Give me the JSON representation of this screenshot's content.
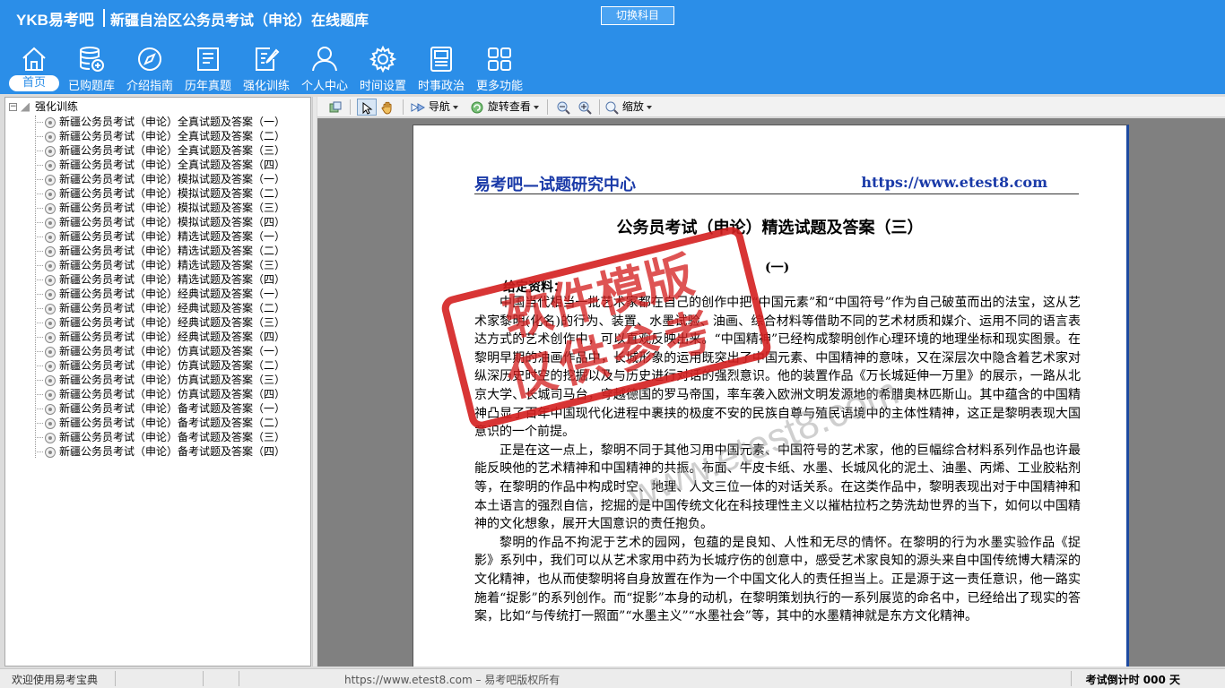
{
  "header": {
    "logo": "YKB易考吧",
    "title": "新疆自治区公务员考试（申论）在线题库",
    "switch_label": "切换科目"
  },
  "nav": {
    "items": [
      {
        "label": "首页",
        "icon": "home-icon"
      },
      {
        "label": "已购题库",
        "icon": "database-icon"
      },
      {
        "label": "介绍指南",
        "icon": "compass-icon"
      },
      {
        "label": "历年真题",
        "icon": "document-list-icon"
      },
      {
        "label": "强化训练",
        "icon": "edit-document-icon"
      },
      {
        "label": "个人中心",
        "icon": "user-icon"
      },
      {
        "label": "时间设置",
        "icon": "gear-icon"
      },
      {
        "label": "时事政治",
        "icon": "news-icon"
      },
      {
        "label": "更多功能",
        "icon": "grid-icon"
      }
    ],
    "active": 0
  },
  "tree": {
    "root": "强化训练",
    "items": [
      "新疆公务员考试（申论）全真试题及答案（一）",
      "新疆公务员考试（申论）全真试题及答案（二）",
      "新疆公务员考试（申论）全真试题及答案（三）",
      "新疆公务员考试（申论）全真试题及答案（四）",
      "新疆公务员考试（申论）模拟试题及答案（一）",
      "新疆公务员考试（申论）模拟试题及答案（二）",
      "新疆公务员考试（申论）模拟试题及答案（三）",
      "新疆公务员考试（申论）模拟试题及答案（四）",
      "新疆公务员考试（申论）精选试题及答案（一）",
      "新疆公务员考试（申论）精选试题及答案（二）",
      "新疆公务员考试（申论）精选试题及答案（三）",
      "新疆公务员考试（申论）精选试题及答案（四）",
      "新疆公务员考试（申论）经典试题及答案（一）",
      "新疆公务员考试（申论）经典试题及答案（二）",
      "新疆公务员考试（申论）经典试题及答案（三）",
      "新疆公务员考试（申论）经典试题及答案（四）",
      "新疆公务员考试（申论）仿真试题及答案（一）",
      "新疆公务员考试（申论）仿真试题及答案（二）",
      "新疆公务员考试（申论）仿真试题及答案（三）",
      "新疆公务员考试（申论）仿真试题及答案（四）",
      "新疆公务员考试（申论）备考试题及答案（一）",
      "新疆公务员考试（申论）备考试题及答案（二）",
      "新疆公务员考试（申论）备考试题及答案（三）",
      "新疆公务员考试（申论）备考试题及答案（四）"
    ]
  },
  "toolbar": {
    "navigate": "导航",
    "rotate": "旋转查看",
    "zoom": "缩放"
  },
  "document": {
    "header_left": "易考吧—试题研究中心",
    "header_right": "https://www.etest8.com",
    "title": "公务员考试（申论）精选试题及答案（三）",
    "section": "(一)",
    "given_label": "给定资料：",
    "paragraphs": [
      "中国当代相当一批艺术家都在自己的创作中把“中国元素”和“中国符号”作为自己破茧而出的法宝，这从艺术家黎明(化名)的行为、装置、水墨试验、油画、综合材料等借助不同的艺术材质和媒介、运用不同的语言表达方式的艺术创作中，可以直观反映出来。“中国精神”已经构成黎明创作心理环境的地理坐标和现实图景。在黎明早期的油画作品中，长城形象的运用既突出了中国元素、中国精神的意味，又在深层次中隐含着艺术家对纵深历史时空的挖掘以及与历史进行对话的强烈意识。他的装置作品《万长城延伸一万里》的展示，一路从北京大学、长城司马台，穿越德国的罗马帝国，率车袭入欧洲文明发源地的希腊奥林匹斯山。其中蕴含的中国精神凸显了百年中国现代化进程中裹挟的极度不安的民族自尊与殖民语境中的主体性精神，这正是黎明表现大国意识的一个前提。",
      "正是在这一点上，黎明不同于其他习用中国元素、中国符号的艺术家，他的巨幅综合材料系列作品也许最能反映他的艺术精神和中国精神的共振。布面、牛皮卡纸、水墨、长城风化的泥土、油墨、丙烯、工业胶粘剂等，在黎明的作品中构成时空、地理、人文三位一体的对话关系。在这类作品中，黎明表现出对于中国精神和本土语言的强烈自信，挖掘的是中国传统文化在科技理性主义以摧枯拉朽之势洗劫世界的当下，如何以中国精神的文化想象，展开大国意识的责任抱负。",
      "黎明的作品不拘泥于艺术的园网，包蕴的是良知、人性和无尽的情怀。在黎明的行为水墨实验作品《捉影》系列中，我们可以从艺术家用中药为长城疗伤的创意中，感受艺术家良知的源头来自中国传统博大精深的文化精神，也从而使黎明将自身放置在作为一个中国文化人的责任担当上。正是源于这一责任意识，他一路实施着“捉影”的系列创作。而“捉影”本身的动机，在黎明策划执行的一系列展览的命名中，已经给出了现实的答案，比如“与传统打一照面”“水墨主义”“水墨社会”等，其中的水墨精神就是东方文化精神。"
    ],
    "stamp_line1": "软件模版",
    "stamp_line2": "仅供参考",
    "watermark": "www.etest8.com"
  },
  "status": {
    "welcome": "欢迎使用易考宝典",
    "copyright": "https://www.etest8.com – 易考吧版权所有",
    "countdown": "考试倒计时 000 天"
  }
}
